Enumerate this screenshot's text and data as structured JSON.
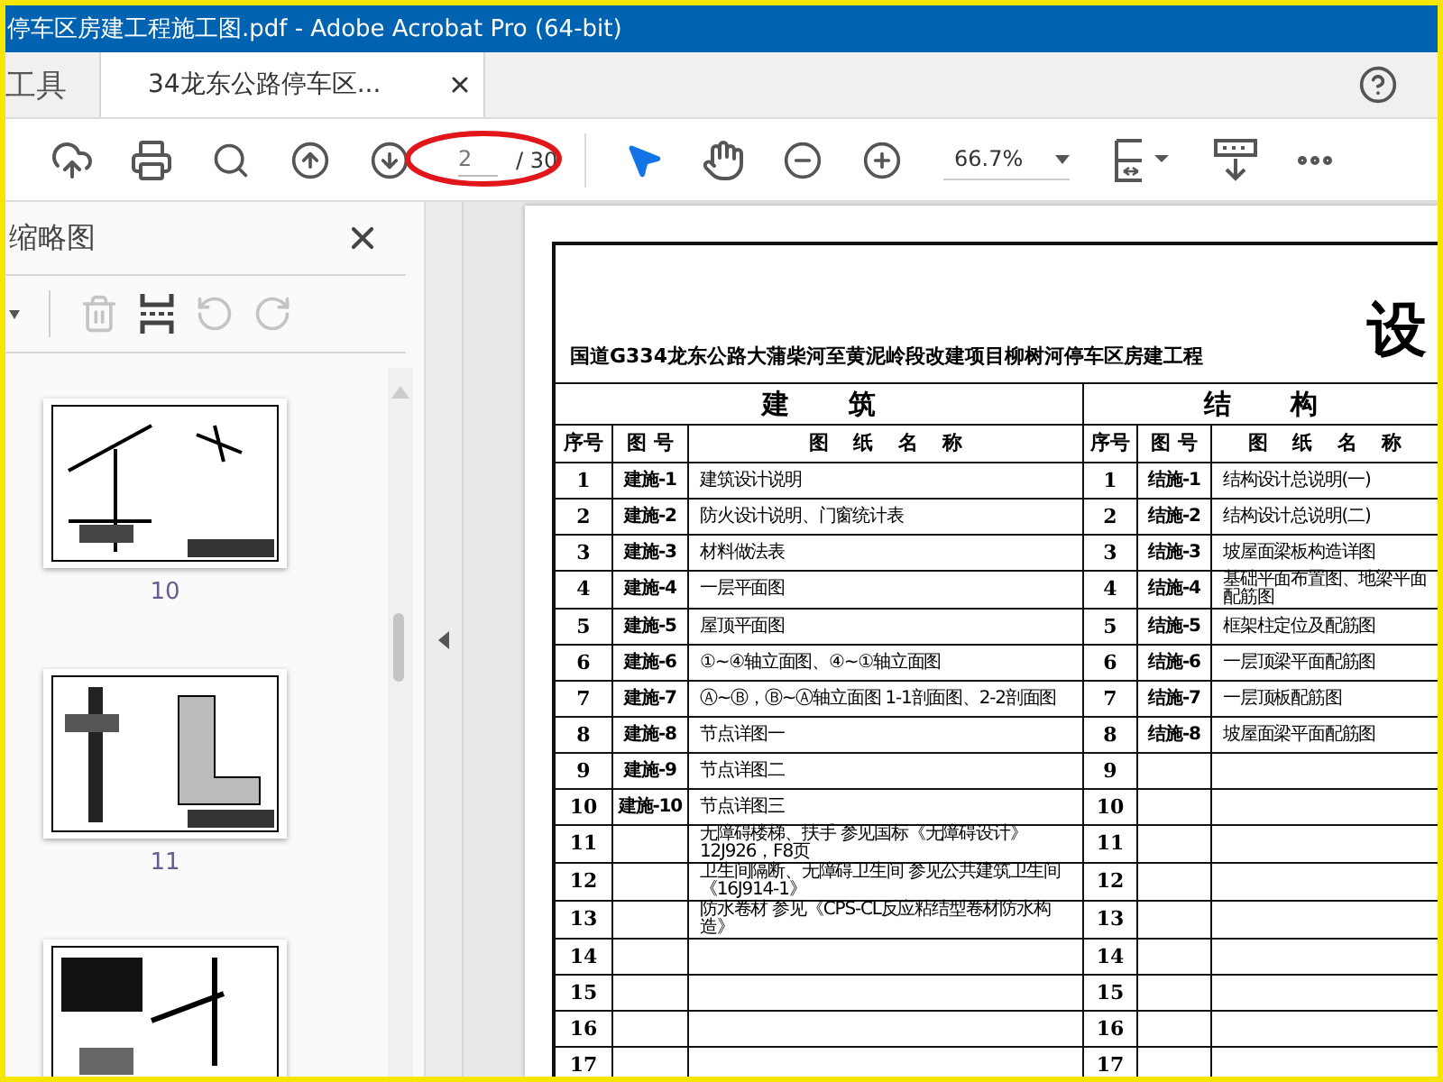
{
  "window": {
    "title": "停车区房建工程施工图.pdf - Adobe Acrobat Pro (64-bit)"
  },
  "tabs": [
    {
      "label": "工具",
      "selected": false
    },
    {
      "label": "34龙东公路停车区...",
      "selected": true
    }
  ],
  "toolbar": {
    "page_field": {
      "value": "2"
    },
    "page_total": "/ 30",
    "zoom": "66.7%",
    "tools": [
      {
        "kind": "select",
        "selected": true
      },
      {
        "kind": "hand",
        "selected": false
      }
    ]
  },
  "sidebar": {
    "title": "缩略图",
    "tools": [
      {
        "kind": "delete",
        "disabled": true
      },
      {
        "kind": "insert",
        "disabled": false
      },
      {
        "kind": "undo",
        "disabled": true
      },
      {
        "kind": "redo",
        "disabled": true
      }
    ],
    "thumbnails": [
      {
        "kind": "picture",
        "label": "10"
      },
      {
        "kind": "picture",
        "label": "11"
      },
      {
        "kind": "picture"
      }
    ]
  },
  "document": {
    "title": "设",
    "project": "国道G334龙东公路大蒲柴河至黄泥岭段改建项目柳树河停车区房建工程",
    "sections": [
      {
        "title": "建 筑",
        "columns": [
          "序号",
          "图 号",
          "图 纸 名 称"
        ]
      },
      {
        "title": "结 构",
        "columns": [
          "序号",
          "图 号",
          "图 纸 名 称"
        ]
      }
    ],
    "rows": [
      {
        "left": {
          "no": "1",
          "code": "建施-1",
          "name": "建筑设计说明"
        },
        "right": {
          "no": "1",
          "code": "结施-1",
          "name": "结构设计总说明(一)"
        }
      },
      {
        "left": {
          "no": "2",
          "code": "建施-2",
          "name": "防火设计说明、门窗统计表"
        },
        "right": {
          "no": "2",
          "code": "结施-2",
          "name": "结构设计总说明(二)"
        }
      },
      {
        "left": {
          "no": "3",
          "code": "建施-3",
          "name": "材料做法表"
        },
        "right": {
          "no": "3",
          "code": "结施-3",
          "name": "坡屋面梁板构造详图"
        }
      },
      {
        "left": {
          "no": "4",
          "code": "建施-4",
          "name": "一层平面图"
        },
        "right": {
          "no": "4",
          "code": "结施-4",
          "name": "基础平面布置图、地梁平面配筋图"
        }
      },
      {
        "left": {
          "no": "5",
          "code": "建施-5",
          "name": "屋顶平面图"
        },
        "right": {
          "no": "5",
          "code": "结施-5",
          "name": "框架柱定位及配筋图"
        }
      },
      {
        "left": {
          "no": "6",
          "code": "建施-6",
          "name": "①~④轴立面图、④~①轴立面图"
        },
        "right": {
          "no": "6",
          "code": "结施-6",
          "name": "一层顶梁平面配筋图"
        }
      },
      {
        "left": {
          "no": "7",
          "code": "建施-7",
          "name": "Ⓐ~Ⓑ，Ⓑ~Ⓐ轴立面图 1-1剖面图、2-2剖面图"
        },
        "right": {
          "no": "7",
          "code": "结施-7",
          "name": "一层顶板配筋图"
        }
      },
      {
        "left": {
          "no": "8",
          "code": "建施-8",
          "name": "节点详图一"
        },
        "right": {
          "no": "8",
          "code": "结施-8",
          "name": "坡屋面梁平面配筋图"
        }
      },
      {
        "left": {
          "no": "9",
          "code": "建施-9",
          "name": "节点详图二"
        },
        "right": {
          "no": "9"
        }
      },
      {
        "left": {
          "no": "10",
          "code": "建施-10",
          "name": "节点详图三"
        },
        "right": {
          "no": "10"
        }
      },
      {
        "left": {
          "no": "11",
          "name": "无障碍楼梯、扶手 参见国标《无障碍设计》12J926，F8页"
        },
        "right": {
          "no": "11"
        }
      },
      {
        "left": {
          "no": "12",
          "name": "卫生间隔断、无障碍卫生间 参见公共建筑卫生间《16J914-1》"
        },
        "right": {
          "no": "12"
        }
      },
      {
        "left": {
          "no": "13",
          "name": "防水卷材 参见《CPS-CL反应粘结型卷材防水构造》"
        },
        "right": {
          "no": "13"
        }
      },
      {
        "left": {
          "no": "14"
        },
        "right": {
          "no": "14"
        }
      },
      {
        "left": {
          "no": "15"
        },
        "right": {
          "no": "15"
        }
      },
      {
        "left": {
          "no": "16"
        },
        "right": {
          "no": "16"
        }
      },
      {
        "left": {
          "no": "17"
        },
        "right": {
          "no": "17"
        }
      }
    ]
  }
}
